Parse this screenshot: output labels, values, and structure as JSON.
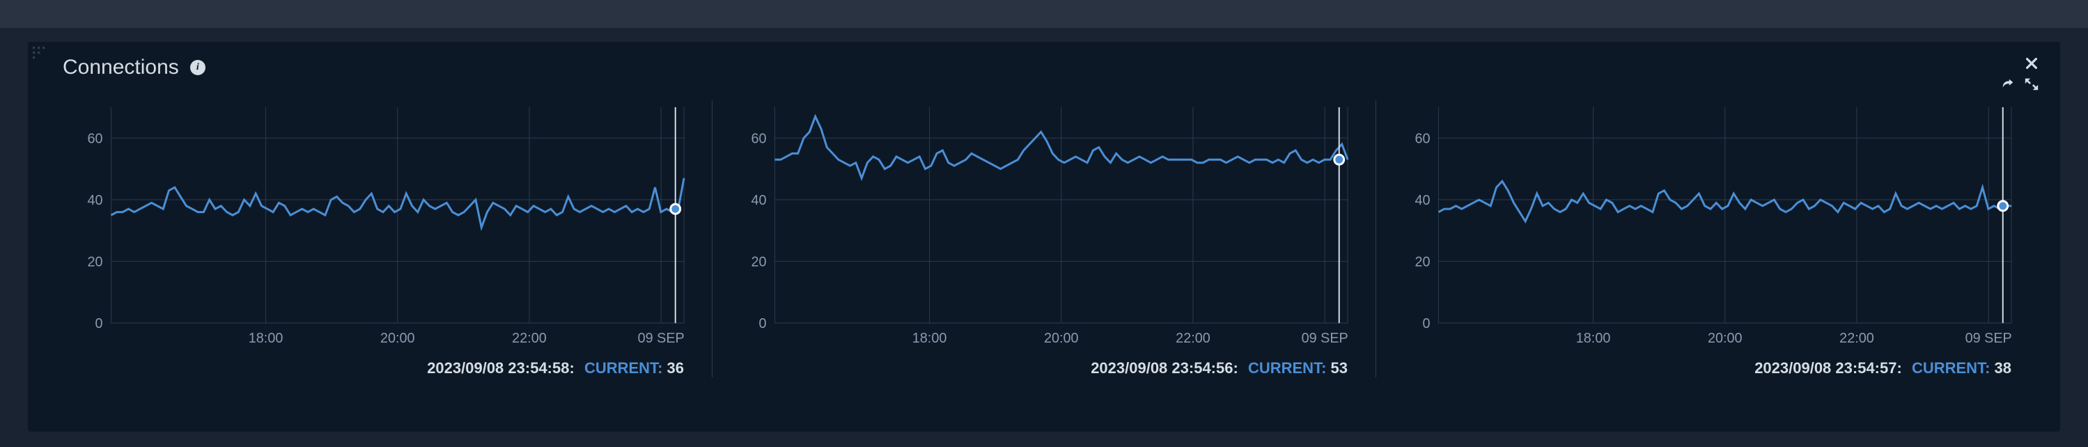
{
  "panel": {
    "title": "Connections",
    "info_tooltip": "i",
    "close_label": "Close",
    "share_label": "Share",
    "expand_label": "Expand"
  },
  "chart_data": [
    {
      "type": "line",
      "title": "",
      "xlabel": "",
      "ylabel": "",
      "ylim": [
        0,
        70
      ],
      "y_ticks": [
        0,
        20,
        40,
        60
      ],
      "x_tick_labels": [
        "18:00",
        "20:00",
        "22:00",
        "09 SEP"
      ],
      "x_tick_positions": [
        0.27,
        0.5,
        0.73,
        0.96
      ],
      "footer_timestamp": "2023/09/08 23:54:58:",
      "footer_metric_label": "CURRENT",
      "footer_value": "36",
      "cursor_x": 0.985,
      "cursor_y": 37,
      "series": [
        {
          "name": "current",
          "values": [
            35,
            36,
            36,
            37,
            36,
            37,
            38,
            39,
            38,
            37,
            43,
            44,
            41,
            38,
            37,
            36,
            36,
            40,
            37,
            38,
            36,
            35,
            36,
            40,
            38,
            42,
            38,
            37,
            36,
            39,
            38,
            35,
            36,
            37,
            36,
            37,
            36,
            35,
            40,
            41,
            39,
            38,
            36,
            37,
            40,
            42,
            37,
            36,
            38,
            36,
            37,
            42,
            38,
            36,
            40,
            38,
            37,
            38,
            39,
            36,
            35,
            36,
            38,
            40,
            31,
            36,
            39,
            38,
            37,
            35,
            38,
            37,
            36,
            38,
            37,
            36,
            37,
            35,
            36,
            41,
            37,
            36,
            37,
            38,
            37,
            36,
            37,
            36,
            37,
            38,
            36,
            37,
            36,
            37,
            44,
            36,
            37,
            36,
            37,
            47
          ]
        }
      ]
    },
    {
      "type": "line",
      "title": "",
      "xlabel": "",
      "ylabel": "",
      "ylim": [
        0,
        70
      ],
      "y_ticks": [
        0,
        20,
        40,
        60
      ],
      "x_tick_labels": [
        "18:00",
        "20:00",
        "22:00",
        "09 SEP"
      ],
      "x_tick_positions": [
        0.27,
        0.5,
        0.73,
        0.96
      ],
      "footer_timestamp": "2023/09/08 23:54:56:",
      "footer_metric_label": "CURRENT",
      "footer_value": "53",
      "cursor_x": 0.985,
      "cursor_y": 53,
      "series": [
        {
          "name": "current",
          "values": [
            53,
            53,
            54,
            55,
            55,
            60,
            62,
            67,
            63,
            57,
            55,
            53,
            52,
            51,
            52,
            47,
            52,
            54,
            53,
            50,
            51,
            54,
            53,
            52,
            53,
            54,
            50,
            51,
            55,
            56,
            52,
            51,
            52,
            53,
            55,
            54,
            53,
            52,
            51,
            50,
            51,
            52,
            53,
            56,
            58,
            60,
            62,
            59,
            55,
            53,
            52,
            53,
            54,
            53,
            52,
            56,
            57,
            54,
            52,
            55,
            53,
            52,
            53,
            54,
            53,
            52,
            53,
            54,
            53,
            53,
            53,
            53,
            53,
            52,
            52,
            53,
            53,
            53,
            52,
            53,
            54,
            53,
            52,
            53,
            53,
            53,
            52,
            53,
            52,
            55,
            56,
            53,
            52,
            53,
            52,
            53,
            53,
            56,
            58,
            53
          ]
        }
      ]
    },
    {
      "type": "line",
      "title": "",
      "xlabel": "",
      "ylabel": "",
      "ylim": [
        0,
        70
      ],
      "y_ticks": [
        0,
        20,
        40,
        60
      ],
      "x_tick_labels": [
        "18:00",
        "20:00",
        "22:00",
        "09 SEP"
      ],
      "x_tick_positions": [
        0.27,
        0.5,
        0.73,
        0.96
      ],
      "footer_timestamp": "2023/09/08 23:54:57:",
      "footer_metric_label": "CURRENT",
      "footer_value": "38",
      "cursor_x": 0.985,
      "cursor_y": 38,
      "series": [
        {
          "name": "current",
          "values": [
            36,
            37,
            37,
            38,
            37,
            38,
            39,
            40,
            39,
            38,
            44,
            46,
            43,
            39,
            36,
            33,
            37,
            42,
            38,
            39,
            37,
            36,
            37,
            40,
            39,
            42,
            39,
            38,
            37,
            40,
            39,
            36,
            37,
            38,
            37,
            38,
            37,
            36,
            42,
            43,
            40,
            39,
            37,
            38,
            40,
            42,
            38,
            37,
            39,
            37,
            38,
            42,
            39,
            37,
            40,
            39,
            38,
            39,
            40,
            37,
            36,
            37,
            39,
            40,
            37,
            38,
            40,
            39,
            38,
            36,
            39,
            38,
            37,
            39,
            38,
            37,
            38,
            36,
            37,
            42,
            38,
            37,
            38,
            39,
            38,
            37,
            38,
            37,
            38,
            39,
            37,
            38,
            37,
            38,
            44,
            37,
            38,
            37,
            38,
            38
          ]
        }
      ]
    }
  ]
}
